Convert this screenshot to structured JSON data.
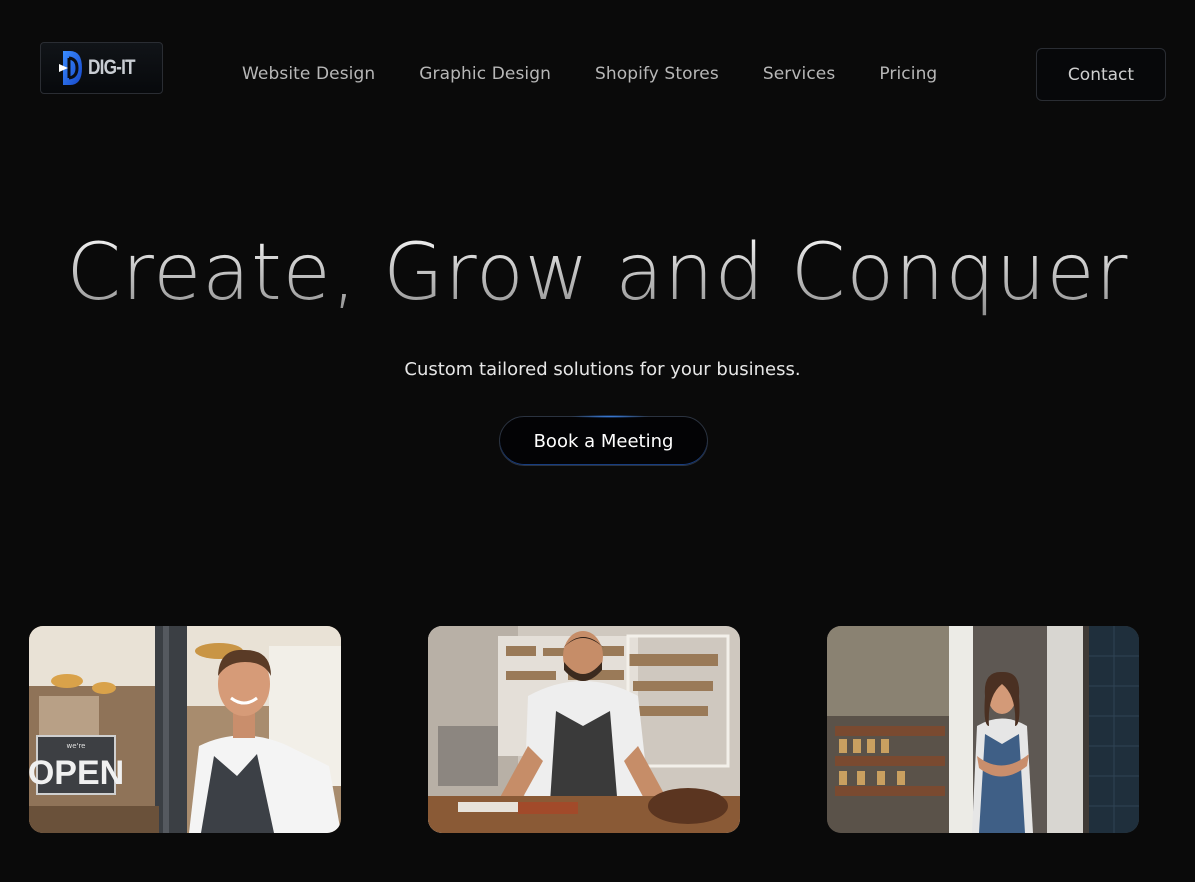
{
  "header": {
    "logo_text": "DIG-IT",
    "nav": [
      {
        "label": "Website Design"
      },
      {
        "label": "Graphic Design"
      },
      {
        "label": "Shopify Stores"
      },
      {
        "label": "Services"
      },
      {
        "label": "Pricing"
      }
    ],
    "contact_label": "Contact"
  },
  "hero": {
    "title": "Create, Grow and Conquer",
    "subtitle": "Custom tailored solutions for your business.",
    "cta_label": "Book a Meeting",
    "accent_color": "#2f7df6"
  },
  "cards": [
    {
      "subject": "smiling man in apron at cafe door",
      "sign_small": "we're",
      "sign_text": "OPEN"
    },
    {
      "subject": "craftsman in leather workshop"
    },
    {
      "subject": "woman in apron at shop entrance"
    }
  ]
}
